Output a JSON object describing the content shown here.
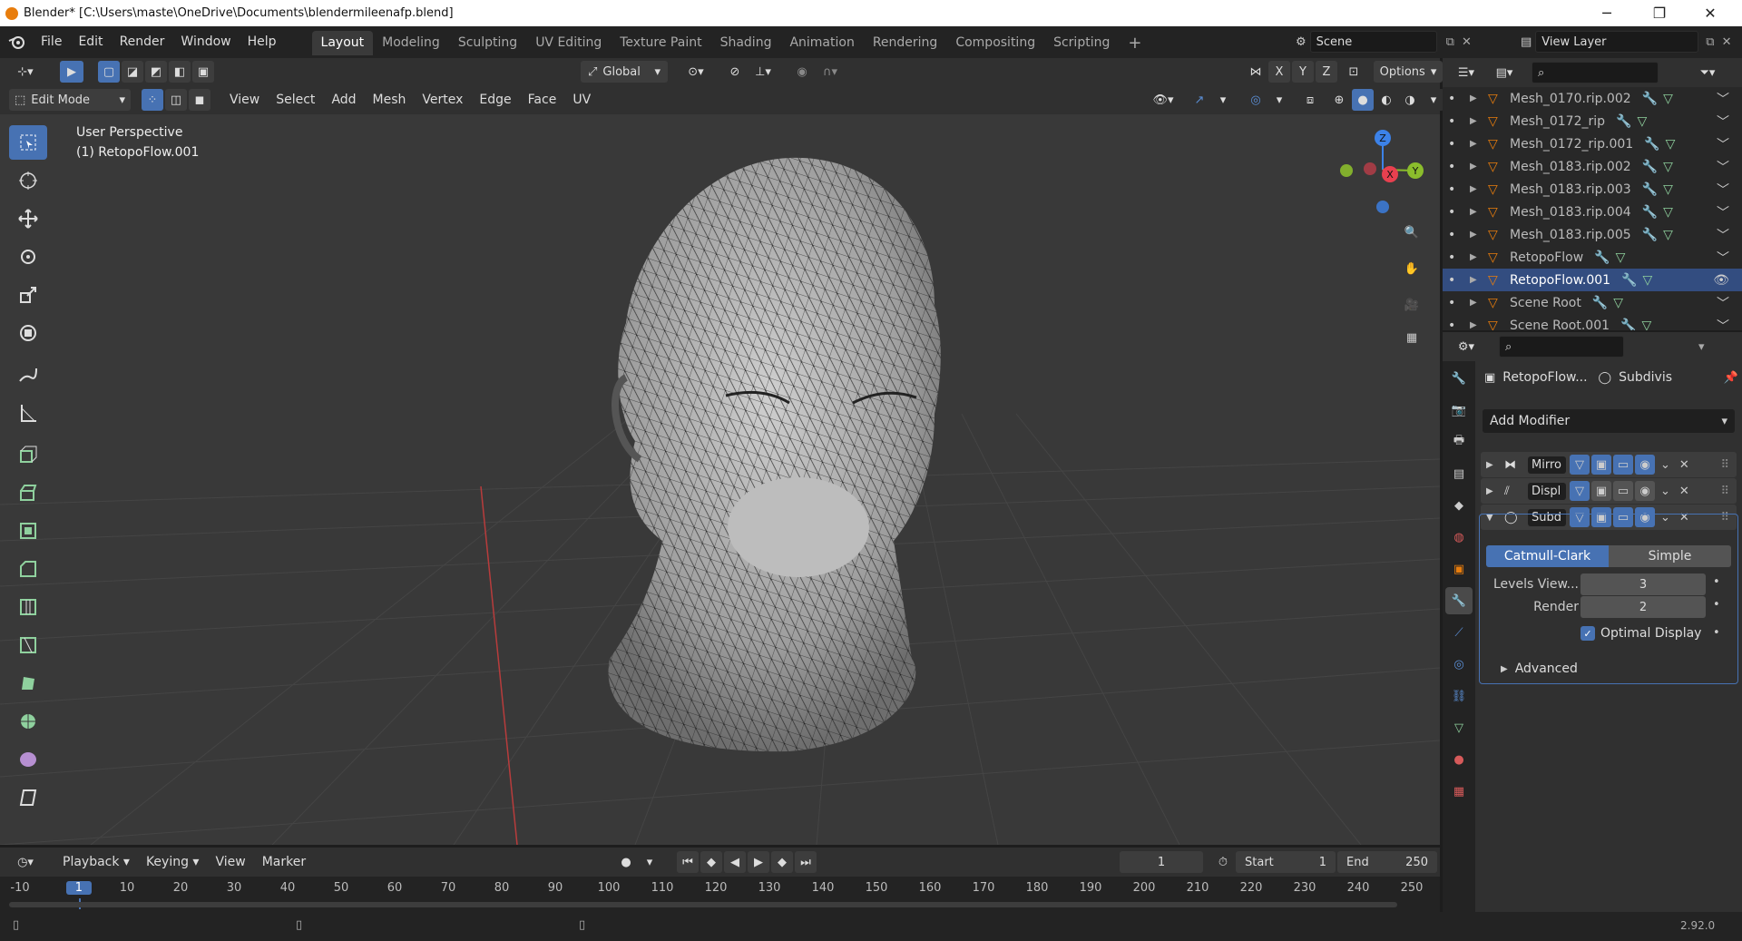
{
  "title_bar": {
    "title": "Blender* [C:\\Users\\maste\\OneDrive\\Documents\\blendermileenafp.blend]",
    "minimize": "─",
    "maximize": "❐",
    "close": "✕"
  },
  "menu": [
    "File",
    "Edit",
    "Render",
    "Window",
    "Help"
  ],
  "workspaces": [
    "Layout",
    "Modeling",
    "Sculpting",
    "UV Editing",
    "Texture Paint",
    "Shading",
    "Animation",
    "Rendering",
    "Compositing",
    "Scripting"
  ],
  "active_workspace": "Layout",
  "scene": {
    "name": "Scene",
    "view_layer": "View Layer"
  },
  "viewport_header": {
    "orientation": "Global",
    "options": "Options",
    "axes": [
      "X",
      "Y",
      "Z"
    ],
    "mode": "Edit Mode",
    "menus": [
      "View",
      "Select",
      "Add",
      "Mesh",
      "Vertex",
      "Edge",
      "Face",
      "UV"
    ]
  },
  "viewport": {
    "perspective": "User Perspective",
    "object": "(1) RetopoFlow.001"
  },
  "gizmo": {
    "x": "X",
    "y": "Y",
    "z": "Z"
  },
  "outliner": {
    "items": [
      {
        "name": "Mesh_0170.rip.002",
        "selected": false
      },
      {
        "name": "Mesh_0172_rip",
        "selected": false
      },
      {
        "name": "Mesh_0172_rip.001",
        "selected": false
      },
      {
        "name": "Mesh_0183.rip.002",
        "selected": false
      },
      {
        "name": "Mesh_0183.rip.003",
        "selected": false
      },
      {
        "name": "Mesh_0183.rip.004",
        "selected": false
      },
      {
        "name": "Mesh_0183.rip.005",
        "selected": false
      },
      {
        "name": "RetopoFlow",
        "selected": false
      },
      {
        "name": "RetopoFlow.001",
        "selected": true
      },
      {
        "name": "Scene Root",
        "selected": false
      },
      {
        "name": "Scene Root.001",
        "selected": false
      }
    ]
  },
  "properties": {
    "object_name": "RetopoFlow...",
    "modifier_name": "Subdivis",
    "add_modifier": "Add Modifier",
    "modifiers": [
      {
        "name": "Mirro",
        "expanded": false
      },
      {
        "name": "Displ",
        "expanded": false
      },
      {
        "name": "Subd",
        "expanded": true
      }
    ],
    "subdiv": {
      "catmull": "Catmull-Clark",
      "simple": "Simple",
      "levels_label": "Levels View...",
      "levels_value": "3",
      "render_label": "Render",
      "render_value": "2",
      "optimal_display": "Optimal Display",
      "advanced": "Advanced"
    }
  },
  "timeline": {
    "menus": [
      "Playback",
      "Keying",
      "View",
      "Marker"
    ],
    "current_frame": "1",
    "start_label": "Start",
    "start": "1",
    "end_label": "End",
    "end": "250",
    "ruler": [
      "-10",
      "1",
      "10",
      "20",
      "30",
      "40",
      "50",
      "60",
      "70",
      "80",
      "90",
      "100",
      "110",
      "120",
      "130",
      "140",
      "150",
      "160",
      "170",
      "180",
      "190",
      "200",
      "210",
      "220",
      "230",
      "240",
      "250"
    ]
  },
  "status": {
    "version": "2.92.0"
  },
  "colors": {
    "accent": "#4772b3",
    "orange": "#e87d0d",
    "x_axis": "#e8404f",
    "y_axis": "#8bbd2c",
    "z_axis": "#3c82e8"
  }
}
